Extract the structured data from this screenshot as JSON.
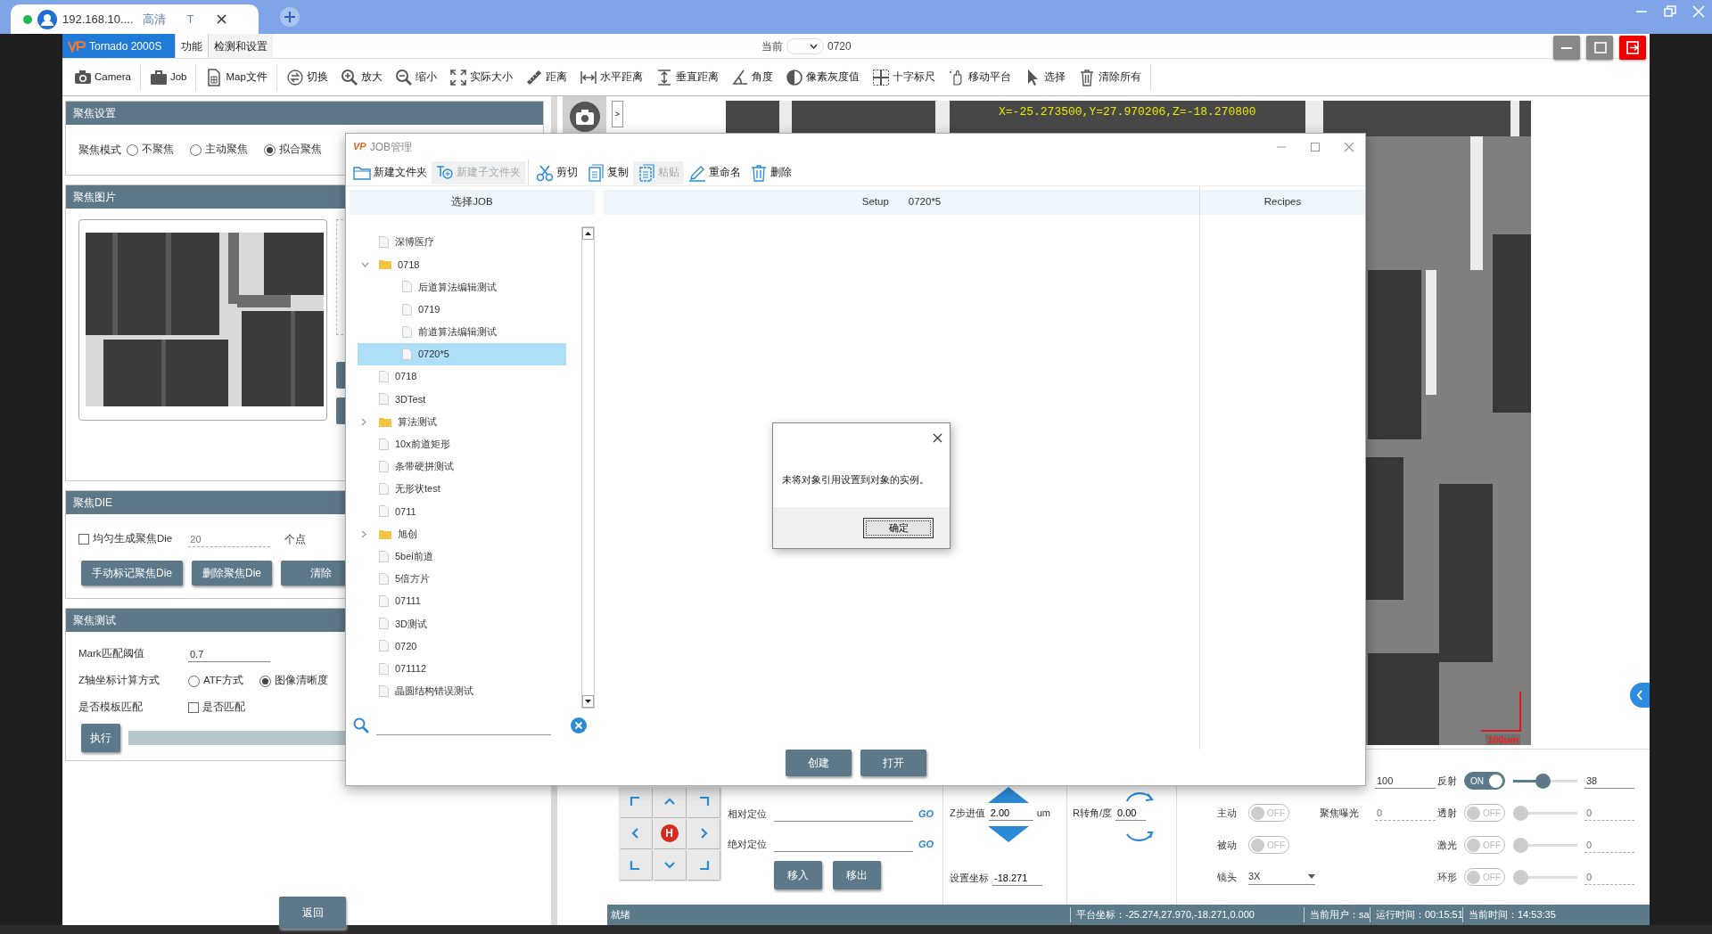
{
  "browser": {
    "tab": {
      "title": "192.168.10....",
      "quality": "高清",
      "letter": "T"
    }
  },
  "app": {
    "logo": "Tornado 2000S",
    "menus": [
      {
        "label": "功能",
        "selected": true
      },
      {
        "label": "检测和设置",
        "selected": false
      }
    ],
    "current": {
      "label": "当前",
      "value": "0720"
    }
  },
  "toolbar": [
    {
      "label": "Camera",
      "group_end": true
    },
    {
      "label": "Job",
      "group_end": true
    },
    {
      "label": "Map文件",
      "group_end": true
    },
    {
      "label": "切换",
      "group_end": false
    },
    {
      "label": "放大",
      "group_end": false
    },
    {
      "label": "缩小",
      "group_end": false
    },
    {
      "label": "实际大小",
      "group_end": false
    },
    {
      "label": "距离",
      "group_end": false
    },
    {
      "label": "水平距离",
      "group_end": false
    },
    {
      "label": "垂直距离",
      "group_end": false
    },
    {
      "label": "角度",
      "group_end": false
    },
    {
      "label": "像素灰度值",
      "group_end": false
    },
    {
      "label": "十字标尺",
      "group_end": false
    },
    {
      "label": "移动平台",
      "group_end": false
    },
    {
      "label": "选择",
      "group_end": false
    },
    {
      "label": "清除所有",
      "group_end": true
    }
  ],
  "left_panel": {
    "focus_settings": {
      "title": "聚焦设置",
      "mode_label": "聚焦模式",
      "modes": [
        {
          "label": "不聚焦",
          "selected": false
        },
        {
          "label": "主动聚焦",
          "selected": false
        },
        {
          "label": "拟合聚焦",
          "selected": true
        }
      ]
    },
    "focus_image": {
      "title": "聚焦图片"
    },
    "focus_die": {
      "title": "聚焦DIE",
      "even": {
        "label": "均匀生成聚焦Die",
        "checked": false
      },
      "count": {
        "placeholder": "20"
      },
      "unit": "个点",
      "buttons": [
        "手动标记聚焦Die",
        "删除聚焦Die",
        "清除"
      ]
    },
    "focus_test": {
      "title": "聚焦测试",
      "threshold_label": "Mark匹配阈值",
      "threshold_value": "0.7",
      "z_label": "Z轴坐标计算方式",
      "z_modes": [
        {
          "label": "ATF方式",
          "selected": false
        },
        {
          "label": "图像清晰度",
          "selected": true
        }
      ],
      "template_label": "是否模板匹配",
      "template": {
        "label": "是否匹配",
        "checked": false
      },
      "run": "执行",
      "progress": {
        "level": 1
      }
    },
    "back": "返回"
  },
  "viewer": {
    "coordinates": "X=-25.273500,Y=27.970206,Z=-18.270800",
    "scale": "100um",
    "expander": ">"
  },
  "motion": {
    "home": "H",
    "relative": {
      "label": "相对定位",
      "go": "GO"
    },
    "absolute": {
      "label": "绝对定位",
      "go": "GO"
    },
    "buttons": [
      "移入",
      "移出"
    ]
  },
  "z_axis": {
    "label": "Z步进值",
    "value": "2.00",
    "unit": "um",
    "set_label": "设置坐标",
    "set_value": "-18.271"
  },
  "rotation": {
    "label": "R转角/度",
    "value": "0.00"
  },
  "camera_controls": {
    "exposure_value": "100",
    "focus_modes": [
      {
        "label": "主动",
        "on": false,
        "text": "OFF"
      },
      {
        "label": "被动",
        "on": false,
        "text": "OFF"
      }
    ],
    "focus_exposure": {
      "label": "聚焦曝光",
      "placeholder": "0"
    },
    "lens": {
      "label": "镜头",
      "value": "3X"
    },
    "lights": [
      {
        "label": "反射",
        "on": true,
        "text": "ON",
        "level": 0.45,
        "value": "38"
      },
      {
        "label": "透射",
        "on": false,
        "text": "OFF",
        "level": 0,
        "placeholder": "0"
      },
      {
        "label": "激光",
        "on": false,
        "text": "OFF",
        "level": 0,
        "placeholder": "0"
      },
      {
        "label": "环形",
        "on": false,
        "text": "OFF",
        "level": 0,
        "placeholder": "0"
      }
    ]
  },
  "status_bar": {
    "ready": "就绪",
    "platform": "平台坐标：-25.274,27.970,-18.271,0.000",
    "user": "当前用户：sa",
    "runtime": "运行时间：00:15:51",
    "clock": "当前时间：14:53:35"
  },
  "job_dialog": {
    "logo": "VP",
    "title": "JOB管理",
    "tools": [
      {
        "label": "新建文件夹",
        "disabled": false,
        "group_end": false
      },
      {
        "label": "新建子文件夹",
        "disabled": true,
        "group_end": true
      },
      {
        "label": "剪切",
        "disabled": false,
        "group_end": false
      },
      {
        "label": "复制",
        "disabled": false,
        "group_end": false
      },
      {
        "label": "粘贴",
        "disabled": true,
        "group_end": false
      },
      {
        "label": "重命名",
        "disabled": false,
        "group_end": false
      },
      {
        "label": "删除",
        "disabled": false,
        "group_end": false
      }
    ],
    "columns": [
      "选择JOB",
      "Setup",
      "Recipes"
    ],
    "setup_name": "0720*5",
    "tree": [
      {
        "label": "深博医疗",
        "kind": "file",
        "selected": false
      },
      {
        "label": "0718",
        "kind": "folder",
        "selected": false,
        "expanded": true,
        "children": [
          {
            "label": "后道算法编辑测试",
            "kind": "file",
            "selected": false
          },
          {
            "label": "0719",
            "kind": "file",
            "selected": false
          },
          {
            "label": "前道算法编辑测试",
            "kind": "file",
            "selected": false
          },
          {
            "label": "0720*5",
            "kind": "file",
            "selected": true
          }
        ]
      },
      {
        "label": "0718",
        "kind": "file",
        "selected": false
      },
      {
        "label": "3DTest",
        "kind": "file",
        "selected": false
      },
      {
        "label": "算法测试",
        "kind": "folder",
        "selected": false,
        "expanded": false
      },
      {
        "label": "10x前道矩形",
        "kind": "file",
        "selected": false
      },
      {
        "label": "条带硬拼测试",
        "kind": "file",
        "selected": false
      },
      {
        "label": "无形状test",
        "kind": "file",
        "selected": false
      },
      {
        "label": "0711",
        "kind": "file",
        "selected": false
      },
      {
        "label": "旭创",
        "kind": "folder",
        "selected": false,
        "expanded": false
      },
      {
        "label": "5bei前道",
        "kind": "file",
        "selected": false
      },
      {
        "label": "5倍方片",
        "kind": "file",
        "selected": false
      },
      {
        "label": "07111",
        "kind": "file",
        "selected": false
      },
      {
        "label": "3D测试",
        "kind": "file",
        "selected": false
      },
      {
        "label": "0720",
        "kind": "file",
        "selected": false
      },
      {
        "label": "071112",
        "kind": "file",
        "selected": false
      },
      {
        "label": "晶圆结构错误测试",
        "kind": "file",
        "selected": false
      }
    ],
    "buttons": [
      "创建",
      "打开"
    ]
  },
  "message_box": {
    "text": "未将对象引用设置到对象的实例。",
    "button": "确定"
  }
}
